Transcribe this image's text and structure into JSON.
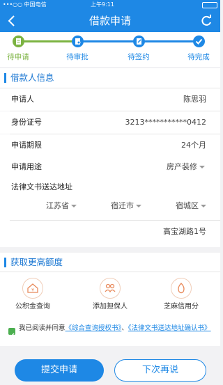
{
  "status_bar": {
    "carrier": "•••○○ 中国电信",
    "time": "上午9:11",
    "battery": ""
  },
  "nav": {
    "title": "借款申请"
  },
  "steps": [
    {
      "label": "待申请",
      "state": "done"
    },
    {
      "label": "待审批",
      "state": "pending"
    },
    {
      "label": "待签约",
      "state": "pending"
    },
    {
      "label": "待完成",
      "state": "pending"
    }
  ],
  "colors": {
    "accent": "#1e88e5",
    "step_done": "#7cb342",
    "step_pending": "#1e88e5"
  },
  "borrower_section": {
    "title": "借款人信息"
  },
  "fields": {
    "applicant": {
      "label": "申请人",
      "value": "陈思羽"
    },
    "id_number": {
      "label": "身份证号",
      "value": "3213***********0412"
    },
    "term": {
      "label": "申请期限",
      "value": "24个月"
    },
    "purpose": {
      "label": "申请用途",
      "value": "房产装修"
    },
    "address": {
      "label": "法律文书送达地址",
      "province": "江苏省",
      "city": "宿迁市",
      "district": "宿城区",
      "street": "高宝湖路1号"
    }
  },
  "quota_section": {
    "title": "获取更高额度"
  },
  "features": [
    {
      "label": "公积金查询",
      "icon": "house-fund-icon"
    },
    {
      "label": "添加担保人",
      "icon": "guarantor-icon"
    },
    {
      "label": "芝麻信用分",
      "icon": "sesame-credit-icon"
    }
  ],
  "agreement": {
    "prefix": "我已阅读并同意",
    "link1": "《综合查询授权书》",
    "separator": "、",
    "link2": "《法律文书送达地址确认书》"
  },
  "buttons": {
    "submit": "提交申请",
    "later": "下次再说"
  }
}
